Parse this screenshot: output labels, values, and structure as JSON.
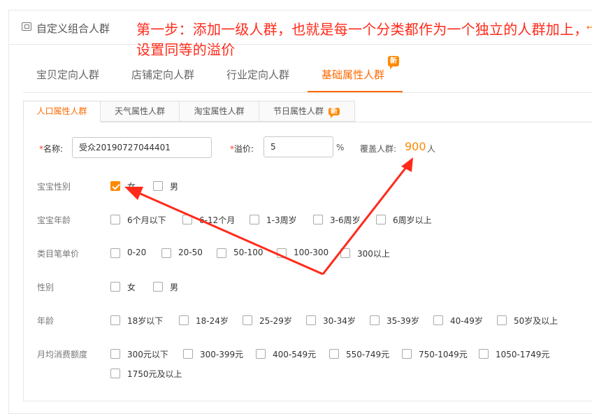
{
  "header": {
    "title": "自定义组合人群",
    "right_glyph": "↩"
  },
  "annotation": "第一步：添加一级人群，也就是每一个分类都作为一个独立的人群加上，设置同等的溢价",
  "main_tabs": [
    {
      "label": "宝贝定向人群"
    },
    {
      "label": "店铺定向人群"
    },
    {
      "label": "行业定向人群"
    },
    {
      "label": "基础属性人群",
      "active": true,
      "badge": "新"
    }
  ],
  "sub_tabs": [
    {
      "label": "人口属性人群",
      "active": true
    },
    {
      "label": "天气属性人群"
    },
    {
      "label": "淘宝属性人群"
    },
    {
      "label": "节日属性人群",
      "badge": "新"
    }
  ],
  "form": {
    "required_mark": "*",
    "name_label": "名称:",
    "name_value": "受众20190727044401",
    "premium_label": "溢价:",
    "premium_value": "5",
    "premium_unit": "%",
    "cover_label": "覆盖人群:",
    "cover_value": "900",
    "cover_unit": "人"
  },
  "rows": [
    {
      "label": "宝宝性别",
      "options": [
        {
          "text": "女",
          "checked": true
        },
        {
          "text": "男"
        }
      ]
    },
    {
      "label": "宝宝年龄",
      "options": [
        {
          "text": "6个月以下"
        },
        {
          "text": "6-12个月"
        },
        {
          "text": "1-3周岁"
        },
        {
          "text": "3-6周岁"
        },
        {
          "text": "6周岁以上"
        }
      ]
    },
    {
      "label": "类目笔单价",
      "options": [
        {
          "text": "0-20"
        },
        {
          "text": "20-50"
        },
        {
          "text": "50-100"
        },
        {
          "text": "100-300"
        },
        {
          "text": "300以上"
        }
      ]
    },
    {
      "label": "性别",
      "options": [
        {
          "text": "女"
        },
        {
          "text": "男"
        }
      ]
    },
    {
      "label": "年龄",
      "options": [
        {
          "text": "18岁以下"
        },
        {
          "text": "18-24岁"
        },
        {
          "text": "25-29岁"
        },
        {
          "text": "30-34岁"
        },
        {
          "text": "35-39岁"
        },
        {
          "text": "40-49岁"
        },
        {
          "text": "50岁及以上"
        }
      ]
    },
    {
      "label": "月均消费额度",
      "options": [
        {
          "text": "300元以下"
        },
        {
          "text": "300-399元"
        },
        {
          "text": "400-549元"
        },
        {
          "text": "550-749元"
        },
        {
          "text": "750-1049元"
        },
        {
          "text": "1050-1749元"
        },
        {
          "text": "1750元及以上"
        }
      ]
    }
  ],
  "colors": {
    "accent": "#ff6a00",
    "badge": "#ff8a00",
    "annotation": "#ff2a1a"
  }
}
